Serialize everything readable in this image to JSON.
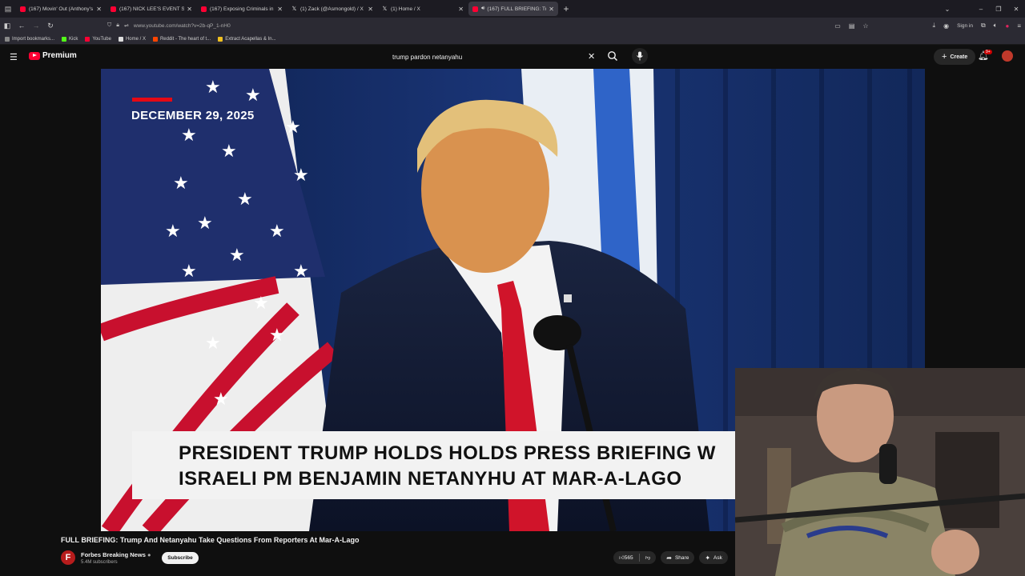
{
  "browser": {
    "tabs": [
      {
        "title": "(167) Movin' Out (Anthony's So",
        "icon": "youtube-icon",
        "active": false
      },
      {
        "title": "(167) NICK LEE'S EVENT SOON",
        "icon": "youtube-icon",
        "active": false
      },
      {
        "title": "(167) Exposing Criminals in Be",
        "icon": "youtube-icon",
        "active": false
      },
      {
        "title": "(1) Zack (@Asmongold) / X",
        "icon": "x-icon",
        "active": false
      },
      {
        "title": "(1) Home / X",
        "icon": "x-icon",
        "active": false
      },
      {
        "title": "(167) FULL BRIEFING: Trum",
        "icon": "youtube-icon",
        "active": true
      }
    ],
    "url": "www.youtube.com/watch?v=2b-qP_1-nH0",
    "sign_in": "Sign in",
    "bookmarks": [
      {
        "label": "Import bookmarks...",
        "color": "#888888"
      },
      {
        "label": "Kick",
        "color": "#53fc18"
      },
      {
        "label": "YouTube",
        "color": "#ff0033"
      },
      {
        "label": "Home / X",
        "color": "#dddddd"
      },
      {
        "label": "Reddit - The heart of t...",
        "color": "#ff4500"
      },
      {
        "label": "Extract Acapellas & In...",
        "color": "#f0c020"
      }
    ]
  },
  "youtube": {
    "logo_text": "Premium",
    "search_value": "trump pardon netanyahu",
    "create_label": "Create",
    "notification_badge": "9+"
  },
  "video": {
    "overlay_date": "DECEMBER 29, 2025",
    "lower_third_line1": "PRESIDENT TRUMP HOLDS HOLDS PRESS BRIEFING W",
    "lower_third_line2": "ISRAELI PM BENJAMIN NETANYHU AT MAR-A-LAGO",
    "title": "FULL BRIEFING: Trump And Netanyahu Take Questions From Reporters At Mar-A-Lago",
    "channel_name": "Forbes Breaking News",
    "channel_initial": "F",
    "subscribers": "5.4M subscribers",
    "subscribe_label": "Subscribe",
    "likes": "565",
    "share_label": "Share",
    "ask_label": "Ask"
  },
  "colors": {
    "accent_red": "#ff0033",
    "background": "#0f0f0f"
  }
}
